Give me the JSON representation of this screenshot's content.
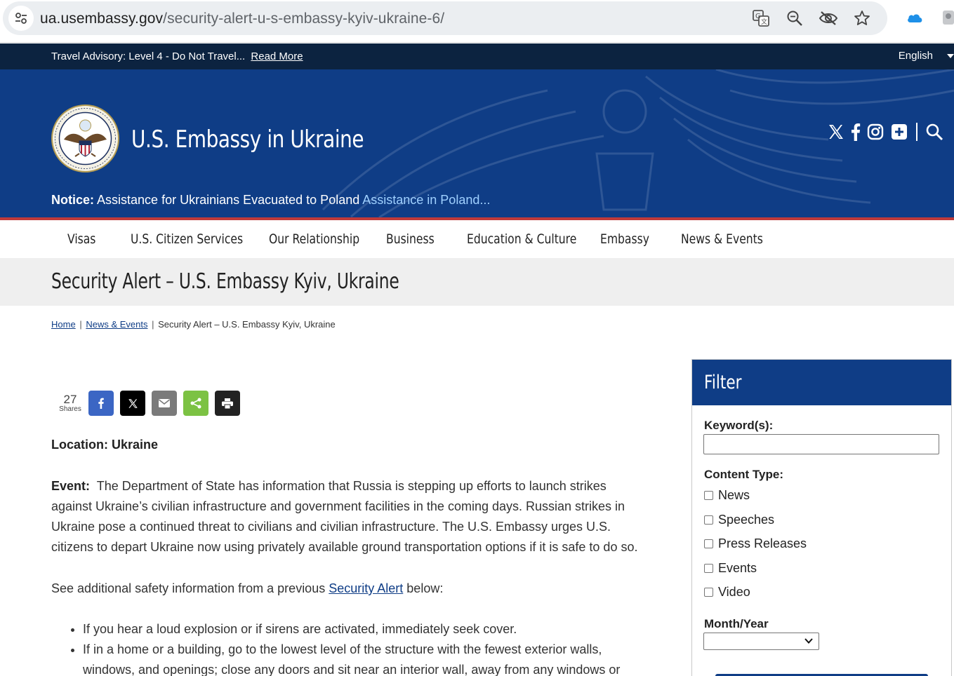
{
  "browser": {
    "url_host": "ua.usembassy.gov",
    "url_path": "/security-alert-u-s-embassy-kyiv-ukraine-6/"
  },
  "advisory": {
    "text": "Travel Advisory: Level 4 - Do Not Travel...",
    "link": "Read More",
    "language": "English"
  },
  "header": {
    "site_title": "U.S. Embassy in Ukraine",
    "notice_label": "Notice:",
    "notice_text": "Assistance for Ukrainians Evacuated to Poland",
    "notice_link": "Assistance in Poland..."
  },
  "nav": {
    "items": [
      {
        "label": "Visas"
      },
      {
        "label": "U.S. Citizen Services"
      },
      {
        "label": "Our Relationship"
      },
      {
        "label": "Business"
      },
      {
        "label": "Education & Culture"
      },
      {
        "label": "Embassy"
      },
      {
        "label": "News & Events"
      }
    ]
  },
  "page": {
    "title": "Security Alert – U.S. Embassy Kyiv, Ukraine",
    "breadcrumb": {
      "home": "Home",
      "section": "News & Events",
      "current": "Security Alert – U.S. Embassy Kyiv, Ukraine",
      "separator": "|"
    }
  },
  "share": {
    "count": "27",
    "count_label": "Shares",
    "colors": {
      "facebook": "#3b66c4",
      "x": "#000000",
      "email": "#7a7a7a",
      "sharethis": "#7cc243",
      "print": "#222222"
    }
  },
  "article": {
    "location_label": "Location:",
    "location_value": "Ukraine",
    "event_label": "Event:",
    "event_text": "The Department of State has information that Russia is stepping up efforts to launch strikes against Ukraine’s civilian infrastructure and government facilities in the coming days. Russian strikes in Ukraine pose a continued threat to civilians and civilian infrastructure. The U.S. Embassy urges U.S. citizens to depart Ukraine now using privately available ground transportation options if it is safe to do so.",
    "additional_prefix": "See additional safety information from a previous",
    "additional_link": "Security Alert",
    "additional_suffix": "below:",
    "bullets": [
      "If you hear a loud explosion or if sirens are activated, immediately seek cover.",
      "If in a home or a building, go to the lowest level of the structure with the fewest exterior walls, windows, and openings; close any doors and sit near an interior wall, away from any windows or"
    ]
  },
  "filter": {
    "title": "Filter",
    "keyword_label": "Keyword(s):",
    "keyword_value": "",
    "content_type_label": "Content Type:",
    "content_types": [
      {
        "label": "News",
        "checked": false
      },
      {
        "label": "Speeches",
        "checked": false
      },
      {
        "label": "Press Releases",
        "checked": false
      },
      {
        "label": "Events",
        "checked": false
      },
      {
        "label": "Video",
        "checked": false
      }
    ],
    "month_year_label": "Month/Year",
    "month_year_value": ""
  },
  "colors": {
    "header_blue": "#0f3d86",
    "advisory_navy": "#0c2340",
    "accent_red": "#bf3a3a",
    "link_light_blue": "#9fd0ff"
  }
}
